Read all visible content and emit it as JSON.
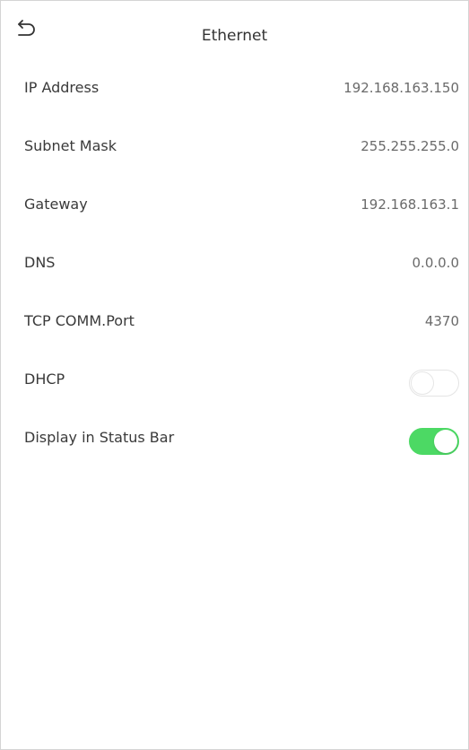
{
  "header": {
    "title": "Ethernet",
    "back_icon": "back-arrow-icon"
  },
  "rows": [
    {
      "label": "IP Address",
      "value": "192.168.163.150"
    },
    {
      "label": "Subnet Mask",
      "value": "255.255.255.0"
    },
    {
      "label": "Gateway",
      "value": "192.168.163.1"
    },
    {
      "label": "DNS",
      "value": "0.0.0.0"
    },
    {
      "label": "TCP COMM.Port",
      "value": "4370"
    }
  ],
  "toggles": [
    {
      "label": "DHCP",
      "on": false
    },
    {
      "label": "Display in Status Bar",
      "on": true
    }
  ],
  "colors": {
    "toggle_on": "#4cd964",
    "toggle_off": "#ffffff",
    "background": "#ffffff"
  }
}
